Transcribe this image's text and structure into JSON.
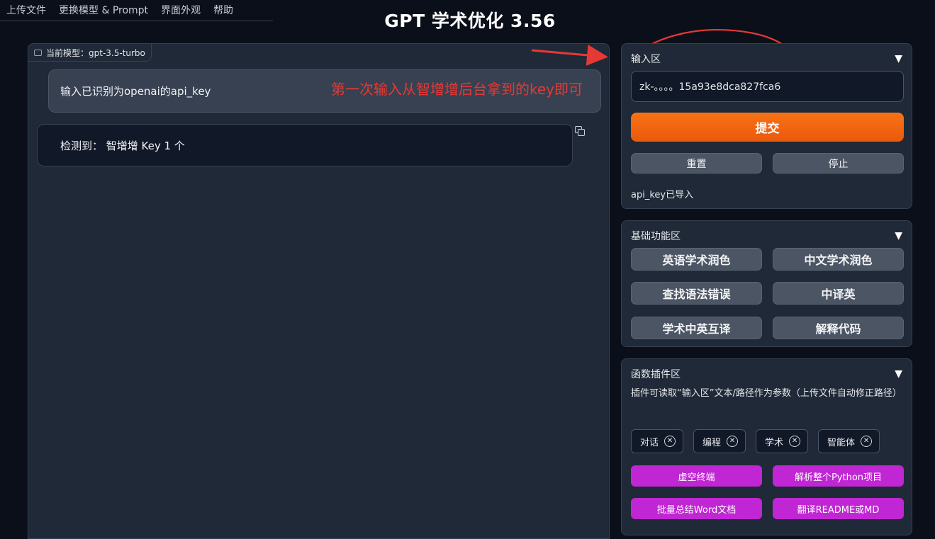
{
  "topnav": {
    "tabs": [
      {
        "label": "上传文件"
      },
      {
        "label": "更换模型 & Prompt"
      },
      {
        "label": "界面外观"
      },
      {
        "label": "帮助"
      }
    ]
  },
  "app_title": "GPT 学术优化 3.56",
  "chat": {
    "model_label": "当前模型：gpt-3.5-turbo",
    "user_message": "输入已识别为openai的api_key",
    "bot_message": "检测到： 智增增 Key 1 个",
    "annotation": "第一次输入从智增增后台拿到的key即可"
  },
  "input_panel": {
    "title": "输入区",
    "key_value": "zk-。。。。15a93e8dca827fca6",
    "submit_label": "提交",
    "reset_label": "重置",
    "stop_label": "停止",
    "status": "api_key已导入"
  },
  "basic_panel": {
    "title": "基础功能区",
    "buttons": [
      {
        "label": "英语学术润色"
      },
      {
        "label": "中文学术润色"
      },
      {
        "label": "查找语法错误"
      },
      {
        "label": "中译英"
      },
      {
        "label": "学术中英互译"
      },
      {
        "label": "解释代码"
      }
    ]
  },
  "plugin_panel": {
    "title": "函数插件区",
    "description": "插件可读取“输入区”文本/路径作为参数（上传文件自动修正路径）",
    "chips": [
      {
        "label": "对话",
        "remove": "✕"
      },
      {
        "label": "编程",
        "remove": "✕"
      },
      {
        "label": "学术",
        "remove": "✕"
      },
      {
        "label": "智能体",
        "remove": "✕"
      }
    ],
    "buttons": [
      {
        "label": "虚空终端"
      },
      {
        "label": "解析整个Python项目"
      },
      {
        "label": "批量总结Word文档"
      },
      {
        "label": "翻译README或MD"
      }
    ]
  },
  "collapse_glyph": "▼",
  "colors": {
    "accent_orange": "#f97316",
    "plugin_purple": "#c026d3",
    "annotation_red": "#e53935",
    "background": "#0b0f19"
  }
}
